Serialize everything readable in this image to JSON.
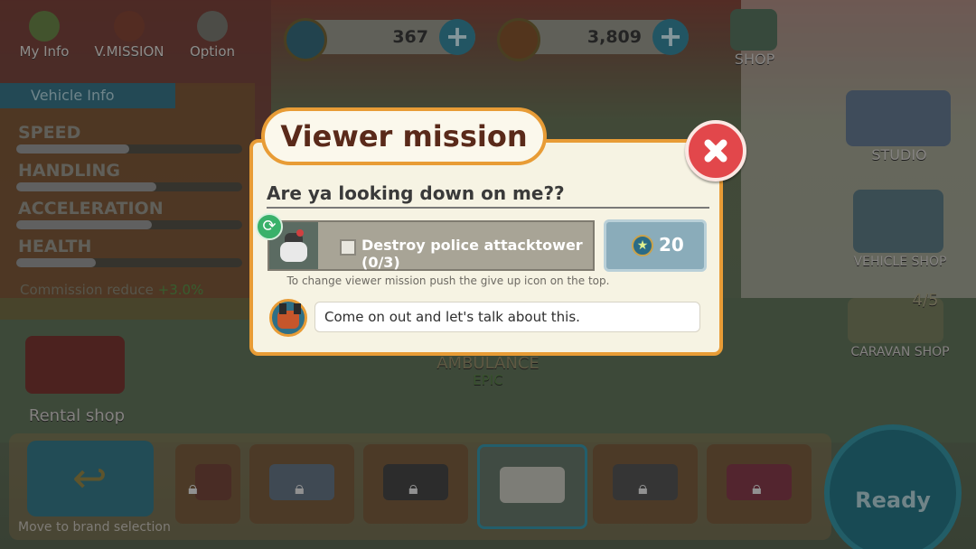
{
  "top_menu": {
    "my_info": "My Info",
    "v_mission": "V.MISSION",
    "option": "Option"
  },
  "currency": {
    "stars": "367",
    "coins": "3,809",
    "plus": "+"
  },
  "right_menu": {
    "shop": "SHOP",
    "studio": "STUDIO",
    "vehicle_shop": "VEHICLE SHOP",
    "caravan_count": "4/5",
    "caravan_shop": "CARAVAN SHOP"
  },
  "vehicle_info": {
    "title": "Vehicle Info",
    "stats": [
      {
        "label": "SPEED",
        "fill": 0.5
      },
      {
        "label": "HANDLING",
        "fill": 0.62
      },
      {
        "label": "ACCELERATION",
        "fill": 0.6
      },
      {
        "label": "HEALTH",
        "fill": 0.35
      }
    ],
    "commission_label": "Commission reduce",
    "commission_value": "+3.0%"
  },
  "left_misc": {
    "rental_shop": "Rental shop"
  },
  "vehicle_name": {
    "name": "AMBULANCE",
    "rarity": "EPIC"
  },
  "bottom_bar": {
    "back_label": "Move to brand selection",
    "ready": "Ready"
  },
  "dialog": {
    "title": "Viewer mission",
    "mission_name": "Are ya looking down on me??",
    "task": "Destroy police attacktower (0/3)",
    "reward": "20",
    "hint": "To change viewer mission push the give up icon on the top.",
    "speech": "Come on out and let's talk about this."
  },
  "colors": {
    "dialog_border": "#e89c36",
    "title_text": "#5a2a1a",
    "close_button": "#e2474b",
    "refresh_icon": "#39b16a",
    "reward_bg": "#8aacba"
  },
  "icons": {
    "close": "close-icon",
    "refresh": "refresh-icon",
    "reward": "star-coin-icon",
    "speaker": "dog-avatar-icon"
  }
}
